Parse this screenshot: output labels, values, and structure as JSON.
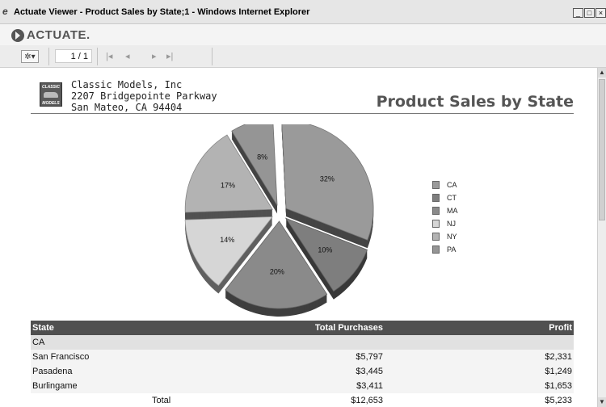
{
  "window": {
    "title": "Actuate Viewer - Product Sales by State;1 - Windows Internet Explorer"
  },
  "brand": {
    "logo_text": "ACTUATE."
  },
  "toolbar": {
    "menu_glyph": "✲▾",
    "page_indicator": "1 / 1"
  },
  "report": {
    "company_logo_top": "CLASSIC",
    "company_logo_bottom": "MODELS",
    "company_name": "Classic Models, Inc",
    "company_address1": "2207 Bridgepointe Parkway",
    "company_address2": "San Mateo, CA 94404",
    "title": "Product Sales by State"
  },
  "chart_data": {
    "type": "pie",
    "categories": [
      "CA",
      "CT",
      "MA",
      "NJ",
      "NY",
      "PA"
    ],
    "values": [
      32,
      10,
      20,
      14,
      17,
      8
    ],
    "labels": [
      "32%",
      "10%",
      "20%",
      "14%",
      "17%",
      "8%"
    ],
    "colors": [
      "#9a9a9a",
      "#7e7e7e",
      "#8a8a8a",
      "#d6d6d6",
      "#b3b3b3",
      "#959595"
    ],
    "legend_position": "right",
    "exploded": true
  },
  "table": {
    "headers": [
      "State",
      "Total Purchases",
      "Profit"
    ],
    "group": "CA",
    "rows": [
      [
        "San Francisco",
        "$5,797",
        "$2,331"
      ],
      [
        "Pasadena",
        "$3,445",
        "$1,249"
      ],
      [
        "Burlingame",
        "$3,411",
        "$1,653"
      ]
    ],
    "total": [
      "Total",
      "$12,653",
      "$5,233"
    ]
  }
}
